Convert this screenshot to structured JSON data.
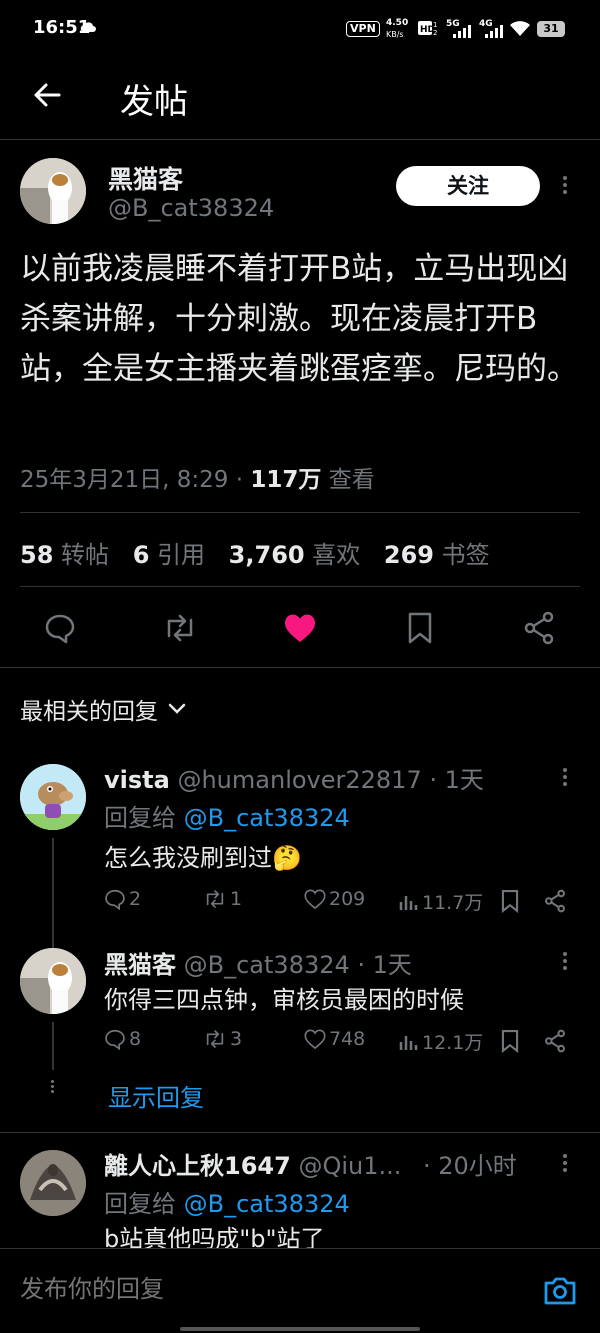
{
  "status_bar": {
    "time": "16:51",
    "vpn": "VPN",
    "net_speed_value": "4.50",
    "net_speed_unit": "KB/s",
    "net_5g": "5G",
    "net_4g": "4G",
    "battery": "31"
  },
  "header": {
    "title": "发帖"
  },
  "post": {
    "display_name": "黑猫客",
    "handle": "@B_cat38324",
    "follow_label": "关注",
    "body": "以前我凌晨睡不着打开B站，立马出现凶杀案讲解，十分刺激。现在凌晨打开B站，全是女主播夹着跳蛋痉挛。尼玛的。",
    "timestamp": "25年3月21日, 8:29 · ",
    "views_count": "117万",
    "views_label": " 查看",
    "stats": {
      "reposts_count": "58",
      "reposts_label": "转帖",
      "quotes_count": "6",
      "quotes_label": "引用",
      "likes_count": "3,760",
      "likes_label": "喜欢",
      "bookmarks_count": "269",
      "bookmarks_label": "书签"
    }
  },
  "replies_sort": {
    "label": "最相关的回复"
  },
  "replies": [
    {
      "name": "vista",
      "handle": "@humanlover22817",
      "time": " · 1天",
      "reply_to_prefix": "回复给 ",
      "reply_to_handle": "@B_cat38324",
      "text": "怎么我没刷到过🤔",
      "comments": "2",
      "reposts": "1",
      "likes": "209",
      "views": "11.7万"
    },
    {
      "name": "黑猫客",
      "handle": "@B_cat38324",
      "time": " · 1天",
      "text": "你得三四点钟，审核员最困的时候",
      "comments": "8",
      "reposts": "3",
      "likes": "748",
      "views": "12.1万"
    },
    {
      "name": "離人心上秋1647",
      "handle": "@Qiu1...",
      "time": " · 20小时",
      "reply_to_prefix": "回复给 ",
      "reply_to_handle": "@B_cat38324",
      "text": "b站真他吗成\"b\"站了"
    }
  ],
  "show_replies_label": "显示回复",
  "compose": {
    "placeholder": "发布你的回复"
  },
  "colors": {
    "accent": "#1d9bf0",
    "like": "#f91880",
    "background": "#000000"
  }
}
